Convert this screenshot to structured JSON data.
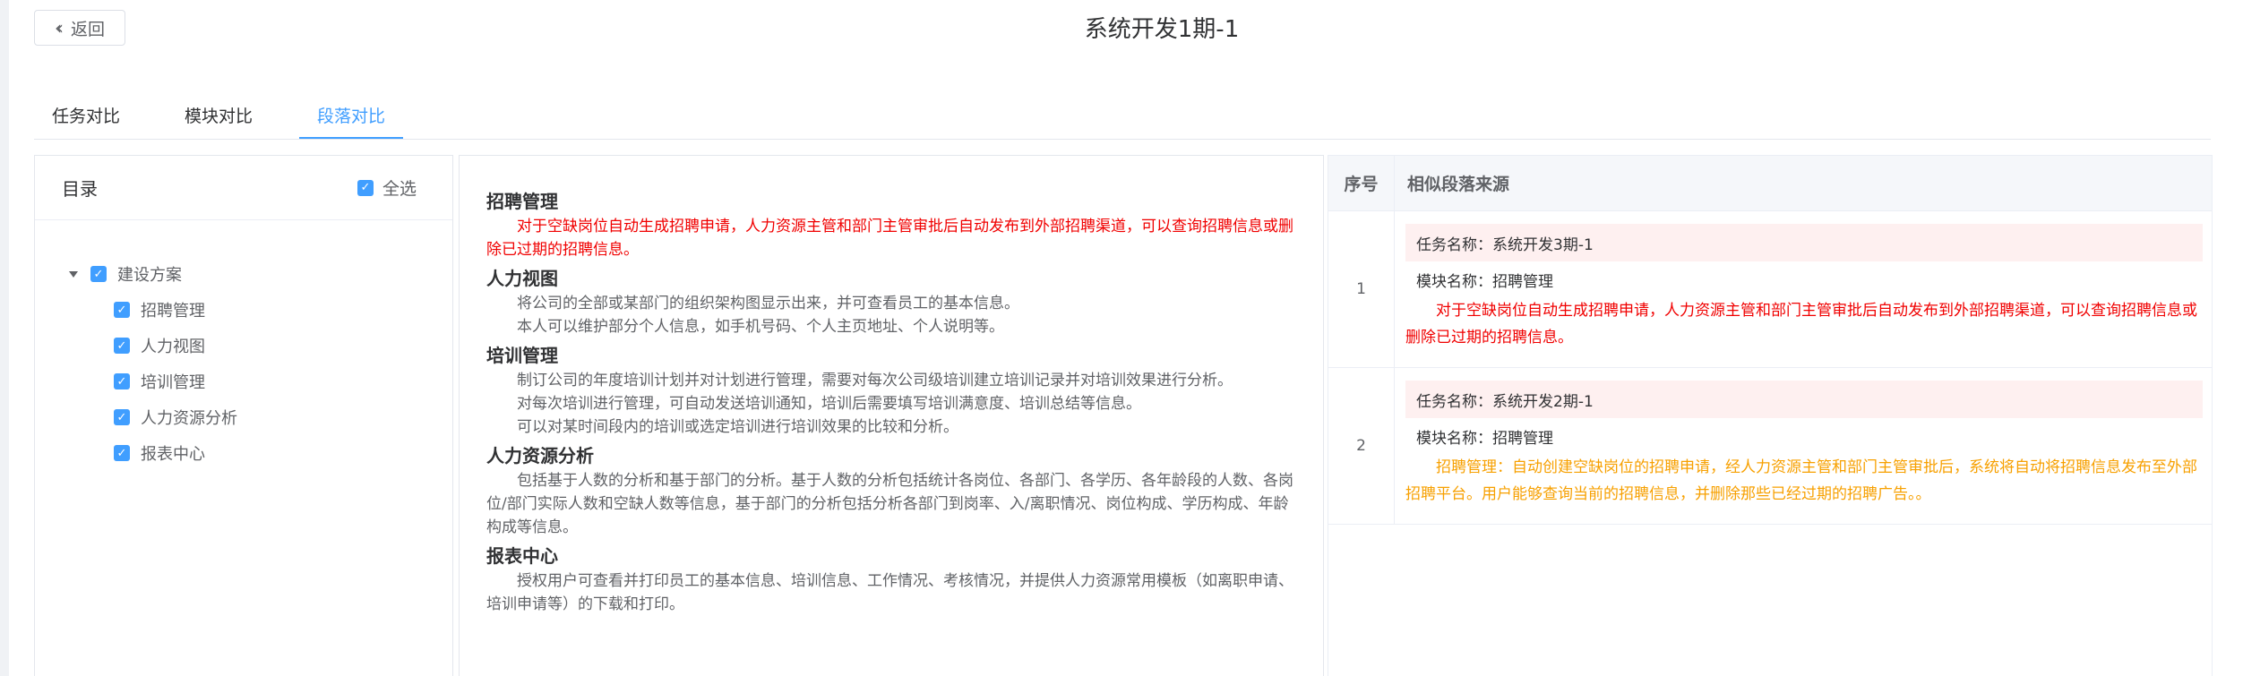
{
  "header": {
    "back_label": "返回",
    "back_icon": "double-chevron-left-icon",
    "title": "系统开发1期-1"
  },
  "tabs": [
    {
      "label": "任务对比",
      "active": false
    },
    {
      "label": "模块对比",
      "active": false
    },
    {
      "label": "段落对比",
      "active": true
    }
  ],
  "toc": {
    "title": "目录",
    "select_all_label": "全选",
    "select_all_checked": true,
    "root": {
      "label": "建设方案",
      "checked": true,
      "expanded": true
    },
    "children": [
      {
        "label": "招聘管理",
        "checked": true
      },
      {
        "label": "人力视图",
        "checked": true
      },
      {
        "label": "培训管理",
        "checked": true
      },
      {
        "label": "人力资源分析",
        "checked": true
      },
      {
        "label": "报表中心",
        "checked": true
      }
    ]
  },
  "content": {
    "sections": [
      {
        "title": "招聘管理",
        "paragraphs": [
          "对于空缺岗位自动生成招聘申请，人力资源主管和部门主管审批后自动发布到外部招聘渠道，可以查询招聘信息或删除已过期的招聘信息。"
        ],
        "highlight": true
      },
      {
        "title": "人力视图",
        "paragraphs": [
          "将公司的全部或某部门的组织架构图显示出来，并可查看员工的基本信息。",
          "本人可以维护部分个人信息，如手机号码、个人主页地址、个人说明等。"
        ],
        "highlight": false
      },
      {
        "title": "培训管理",
        "paragraphs": [
          "制订公司的年度培训计划并对计划进行管理，需要对每次公司级培训建立培训记录并对培训效果进行分析。",
          "对每次培训进行管理，可自动发送培训通知，培训后需要填写培训满意度、培训总结等信息。",
          "可以对某时间段内的培训或选定培训进行培训效果的比较和分析。"
        ],
        "highlight": false
      },
      {
        "title": "人力资源分析",
        "paragraphs": [
          "包括基于人数的分析和基于部门的分析。基于人数的分析包括统计各岗位、各部门、各学历、各年龄段的人数、各岗位/部门实际人数和空缺人数等信息，基于部门的分析包括分析各部门到岗率、入/离职情况、岗位构成、学历构成、年龄构成等信息。"
        ],
        "highlight": false
      },
      {
        "title": "报表中心",
        "paragraphs": [
          "授权用户可查看并打印员工的基本信息、培训信息、工作情况、考核情况，并提供人力资源常用模板（如离职申请、培训申请等）的下载和打印。"
        ],
        "highlight": false
      }
    ]
  },
  "similar_table": {
    "col_no": "序号",
    "col_source": "相似段落来源",
    "task_prefix": "任务名称：",
    "module_prefix": "模块名称：",
    "rows": [
      {
        "no": "1",
        "task": "系统开发3期-1",
        "module": "招聘管理",
        "text": "对于空缺岗位自动生成招聘申请，人力资源主管和部门主管审批后自动发布到外部招聘渠道，可以查询招聘信息或删除已过期的招聘信息。",
        "color": "#f00000"
      },
      {
        "no": "2",
        "task": "系统开发2期-1",
        "module": "招聘管理",
        "text": "招聘管理：自动创建空缺岗位的招聘申请，经人力资源主管和部门主管审批后，系统将自动将招聘信息发布至外部招聘平台。用户能够查询当前的招聘信息，并删除那些已经过期的招聘广告。。",
        "color": "#f7a000"
      }
    ]
  },
  "colors": {
    "accent": "#409eff",
    "red_text": "#f00000",
    "orange_text": "#f7a000",
    "task_bg": "#fef0f0"
  }
}
